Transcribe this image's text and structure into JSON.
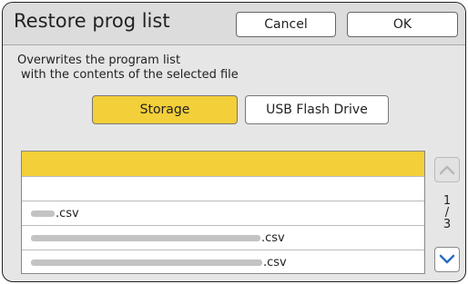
{
  "header": {
    "title": "Restore prog list",
    "cancel_label": "Cancel",
    "ok_label": "OK"
  },
  "description": {
    "line1": "Overwrites the program list",
    "line2": "with the contents of the selected file"
  },
  "source": {
    "storage_label": "Storage",
    "usb_label": "USB Flash Drive",
    "selected": "Storage"
  },
  "files": [
    {
      "name": "",
      "selected": true
    },
    {
      "name": "",
      "selected": false
    },
    {
      "name": ".csv",
      "selected": false
    },
    {
      "name": ".csv",
      "selected": false
    },
    {
      "name": ".csv",
      "selected": false
    }
  ],
  "pager": {
    "current": "1",
    "sep": "/",
    "total": "3"
  },
  "colors": {
    "accent": "#f3cf39",
    "background": "#e6e6e6"
  },
  "icons": {
    "scroll_up": "chevron-up-icon",
    "scroll_down": "chevron-down-icon"
  }
}
